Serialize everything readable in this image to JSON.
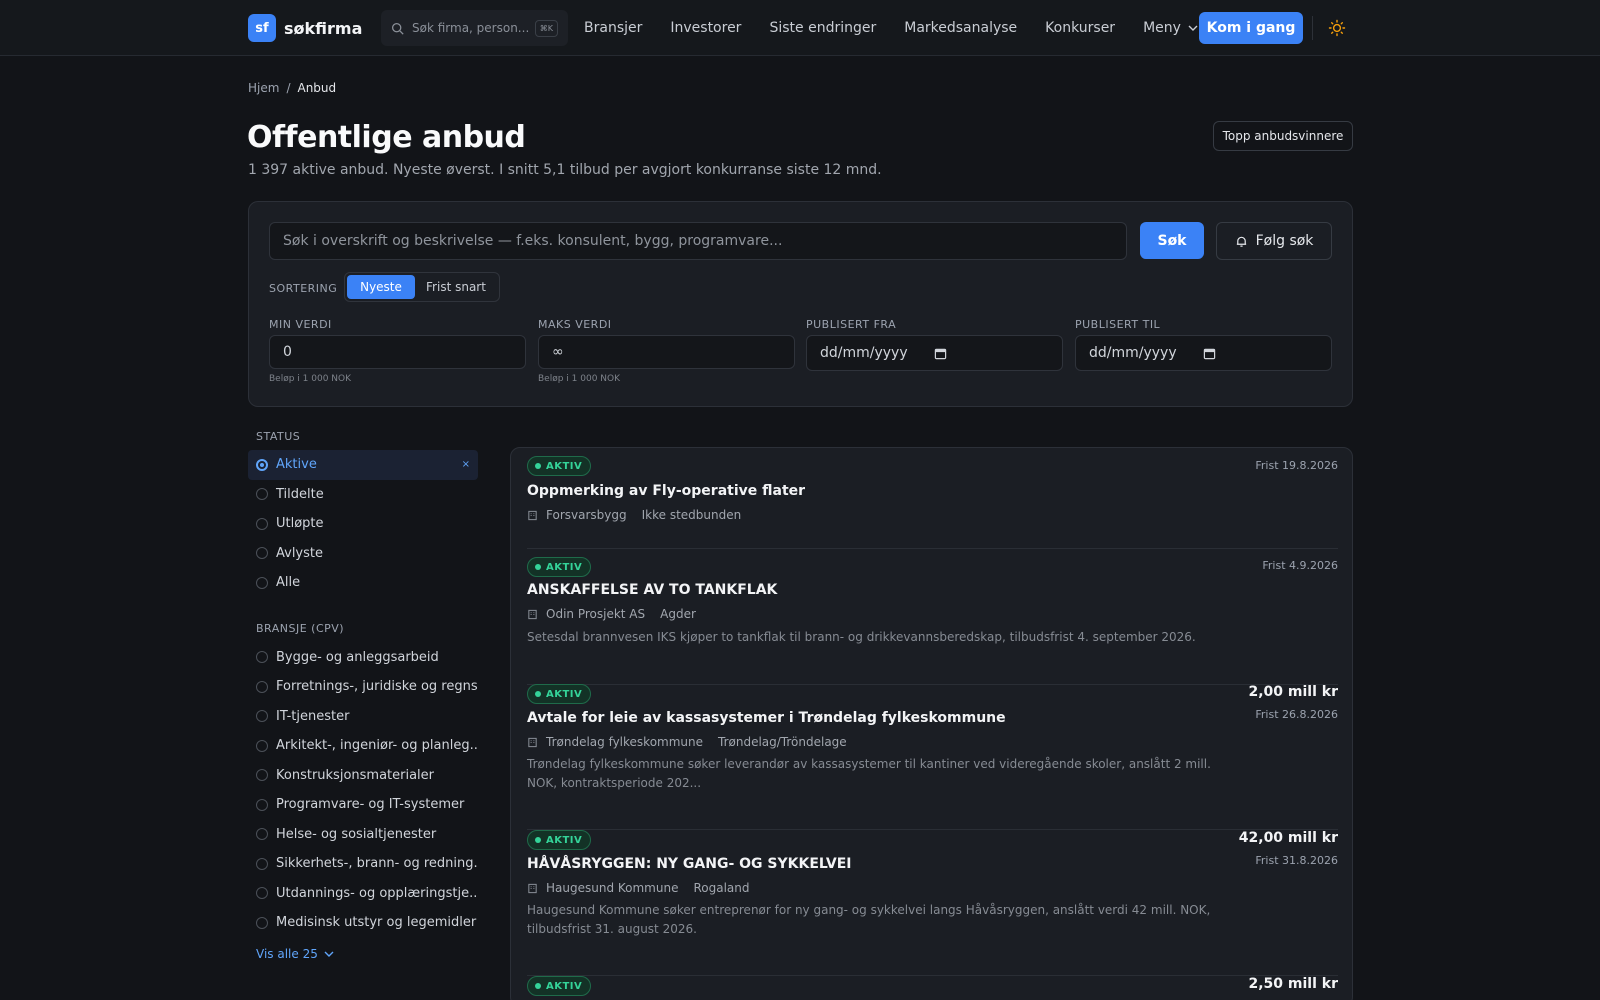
{
  "header": {
    "logo_mark": "sf",
    "logo_text": "søkfirma",
    "search_placeholder": "Søk firma, person...",
    "search_shortcut": "⌘K",
    "nav": [
      "Bransjer",
      "Investorer",
      "Siste endringer",
      "Markedsanalyse",
      "Konkurser",
      "Meny"
    ],
    "cta": "Kom i gang",
    "theme_icon": "sun-icon"
  },
  "breadcrumb": {
    "home": "Hjem",
    "separator": "/",
    "current": "Anbud"
  },
  "page": {
    "title": "Offentlige anbud",
    "subtitle": "1 397 aktive anbud. Nyeste øverst. I snitt 5,1 tilbud per avgjort konkurranse siste 12 mnd.",
    "top_button": "Topp anbudsvinnere"
  },
  "filters": {
    "query_placeholder": "Søk i overskrift og beskrivelse — f.eks. konsulent, bygg, programvare...",
    "search_button": "Søk",
    "follow_button": "Følg søk",
    "sort_label": "SORTERING",
    "sort_options": [
      "Nyeste",
      "Frist snart"
    ],
    "sort_selected": "Nyeste",
    "min_label": "MIN VERDI",
    "min_value": "0",
    "min_help": "Beløp i 1 000 NOK",
    "max_label": "MAKS VERDI",
    "max_value": "∞",
    "max_help": "Beløp i 1 000 NOK",
    "from_label": "PUBLISERT FRA",
    "from_value": "dd/mm/yyyy",
    "to_label": "PUBLISERT TIL",
    "to_value": "dd/mm/yyyy"
  },
  "sidebar": {
    "status_title": "STATUS",
    "status": [
      "Aktive",
      "Tildelte",
      "Utløpte",
      "Avlyste",
      "Alle"
    ],
    "status_selected": "Aktive",
    "clear_symbol": "×",
    "industry_title": "BRANSJE (CPV)",
    "industries": [
      "Bygge- og anleggsarbeid",
      "Forretnings-, juridiske og regns...",
      "IT-tjenester",
      "Arkitekt-, ingeniør- og planleg...",
      "Konstruksjonsmaterialer",
      "Programvare- og IT-systemer",
      "Helse- og sosialtjenester",
      "Sikkerhets-, brann- og redning...",
      "Utdannings- og opplæringstje...",
      "Medisinsk utstyr og legemidler"
    ],
    "show_all": "Vis alle 25"
  },
  "tenders": [
    {
      "status": "AKTIV",
      "title": "Oppmerking av Fly-operative flater",
      "buyer": "Forsvarsbygg",
      "region": "Ikke stedbunden",
      "description": "",
      "amount": "",
      "deadline": "Frist 19.8.2026"
    },
    {
      "status": "AKTIV",
      "title": "ANSKAFFELSE AV TO TANKFLAK",
      "buyer": "Odin Prosjekt AS",
      "region": "Agder",
      "description": "Setesdal brannvesen IKS kjøper to tankflak til brann- og drikkevannsberedskap, tilbudsfrist 4. september 2026.",
      "amount": "",
      "deadline": "Frist 4.9.2026"
    },
    {
      "status": "AKTIV",
      "title": "Avtale for leie av kassasystemer i Trøndelag fylkeskommune",
      "buyer": "Trøndelag fylkeskommune",
      "region": "Trøndelag/Tröndelage",
      "description": "Trøndelag fylkeskommune søker leverandør av kassasystemer til kantiner ved videregående skoler, anslått 2 mill. NOK, kontraktsperiode 202...",
      "amount": "2,00 mill kr",
      "deadline": "Frist 26.8.2026"
    },
    {
      "status": "AKTIV",
      "title": "HÅVÅSRYGGEN: NY GANG- OG SYKKELVEI",
      "buyer": "Haugesund Kommune",
      "region": "Rogaland",
      "description": "Haugesund Kommune søker entreprenør for ny gang- og sykkelvei langs Håvåsryggen, anslått verdi 42 mill. NOK, tilbudsfrist 31. august 2026.",
      "amount": "42,00 mill kr",
      "deadline": "Frist 31.8.2026"
    },
    {
      "status": "AKTIV",
      "title": "",
      "buyer": "",
      "region": "",
      "description": "",
      "amount": "2,50 mill kr",
      "deadline": ""
    }
  ],
  "colors": {
    "accent": "#3b82f6",
    "active": "#34d399",
    "background": "#121418"
  }
}
